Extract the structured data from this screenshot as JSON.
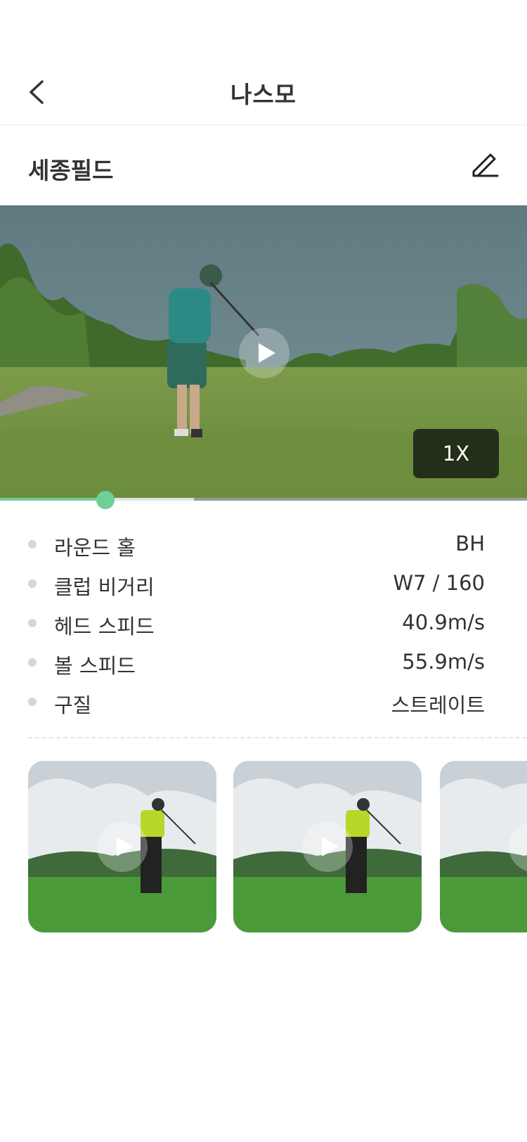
{
  "header": {
    "title": "나스모",
    "back_icon": "chevron-left-icon"
  },
  "venue": {
    "name": "세종필드",
    "edit_icon": "pencil-edit-icon"
  },
  "video": {
    "play_icon": "play-icon",
    "speed_label": "1X",
    "progress_fraction": 0.2,
    "buffered_fraction": 0.37
  },
  "colors": {
    "accent": "#6fcf97",
    "progress_track": "#9a9a9a",
    "dot": "#d6d6d6"
  },
  "stats": [
    {
      "label": "라운드 홀",
      "value": "BH"
    },
    {
      "label": "클럽 비거리",
      "value": "W7 / 160"
    },
    {
      "label": "헤드 스피드",
      "value": "40.9m/s"
    },
    {
      "label": "볼 스피드",
      "value": "55.9m/s"
    },
    {
      "label": "구질",
      "value": "스트레이트"
    }
  ],
  "thumbnails": [
    {
      "play_icon": "play-icon"
    },
    {
      "play_icon": "play-icon"
    },
    {
      "play_icon": "play-icon"
    }
  ]
}
